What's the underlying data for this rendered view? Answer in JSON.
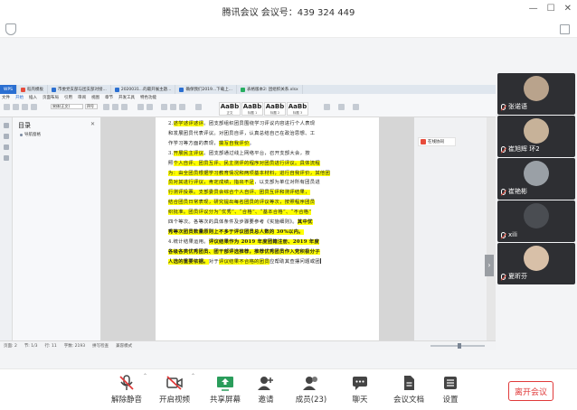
{
  "window": {
    "title": "腾讯会议  会议号：439 324 449"
  },
  "colors": {
    "accent": "#2b6fd1",
    "leave": "#e03a3a",
    "highlight": "#ffff00",
    "tile_bg": "#2e2f33"
  },
  "wps": {
    "tabs": [
      {
        "label": "稻壳模板",
        "color": "#e74c3c"
      },
      {
        "label": "市委党支部与团支部对接...",
        "color": "#2b6fd1"
      },
      {
        "label": "2020031...的最开展主题...",
        "color": "#2b6fd1"
      },
      {
        "label": "确保我们2019...下载上...",
        "color": "#2b6fd1"
      },
      {
        "label": "表格版本2: 团组织关系.xlsx",
        "color": "#27ae60"
      }
    ],
    "menu": [
      "文件",
      "开始",
      "插入",
      "页面布局",
      "引用",
      "审阅",
      "视图",
      "章节",
      "开发工具",
      "特色功能"
    ],
    "active_menu": "开始",
    "font_name": "宋体(正文)",
    "font_size": "四号",
    "styles": [
      {
        "sample": "AaBb",
        "name": "正文"
      },
      {
        "sample": "AaBb",
        "name": "标题 1"
      },
      {
        "sample": "AaBb",
        "name": "标题 2"
      },
      {
        "sample": "AaBb",
        "name": "标题 3"
      }
    ],
    "toc": {
      "title": "目录",
      "close": "✕",
      "item": "导航窗格"
    },
    "side_tag": "在线协同",
    "status": {
      "page": "页面: 2",
      "section": "节: 1/3",
      "column": "行: 11",
      "words": "字数: 2193",
      "spell": "拼写检查",
      "mode": "兼容模式"
    }
  },
  "document": {
    "lines": [
      [
        {
          "t": "2."
        },
        {
          "t": "述学述评述评",
          "c": "hl"
        },
        {
          "t": "。团支部组织团员围绕学习评议内容进行个人表现"
        }
      ],
      [
        {
          "t": "和发展团员代表评议。对团员自评，认真总结自己在政治思想、工"
        }
      ],
      [
        {
          "t": "作学习等方面的表现，"
        },
        {
          "t": "撰写自我评价",
          "c": "hl"
        },
        {
          "t": "。"
        }
      ],
      [
        {
          "t": "3."
        },
        {
          "t": "开展民主评议",
          "c": "hl"
        },
        {
          "t": "。团支部通过线上网络平台，召开支部大会，按"
        }
      ],
      [
        {
          "t": "照"
        },
        {
          "t": "个人自评、团员互评、民主测评",
          "c": "hl"
        },
        {
          "t": "的程序对团员进行评议。具体流程",
          "c": "hl"
        }
      ],
      [
        {
          "t": "为：",
          "c": "hl"
        },
        {
          "t": "由全团员根据学习教育情况和两项基本材料，进行自我评价，其他团",
          "c": "hl"
        }
      ],
      [
        {
          "t": "员对其进行评议，肯定成绩，指出不足",
          "c": "hl"
        },
        {
          "t": "，以支部为单位对所有团员进"
        }
      ],
      [
        {
          "t": "行测评投票。",
          "c": "hl"
        },
        {
          "t": "支部委员会综合个人自评、团员互评和测评结果，",
          "c": "hl"
        }
      ],
      [
        {
          "t": "结合团员日常表现，研究提出每名团员的评议等次，按照程序团员",
          "c": "hl"
        }
      ],
      [
        {
          "t": "织批准。团员评议分为",
          "c": "hl"
        },
        {
          "t": "“优秀”、“合格”、“基本合格”、“不合格”",
          "c": "hl"
        }
      ],
      [
        {
          "t": "四个等次。各等次的具体条件及步骤要参考《实施细则》。"
        },
        {
          "t": "其中优",
          "c": "hl-b"
        }
      ],
      [
        {
          "t": "秀等次团员数量原则上不多于评议团员总人数的 30%以内。",
          "c": "hl-b"
        }
      ],
      [
        {
          "t": "4.统计结果运用。"
        },
        {
          "t": "评议结果作为 2019 年度团籍注册、2019 年度",
          "c": "hl-b"
        }
      ],
      [
        {
          "t": "各级各类优秀团员、团干部评选推荐，推荐优秀团员作入党积极分子",
          "c": "hl-b"
        }
      ],
      [
        {
          "t": "人选的重要依据。",
          "c": "hl-b"
        },
        {
          "t": "对于"
        },
        {
          "t": "评议结果不合格的团员",
          "c": "hl"
        },
        {
          "t": "应帮助其查摆问题或团"
        }
      ]
    ]
  },
  "participants": [
    {
      "name": "张诺语",
      "avatar_color": "#b9a38c"
    },
    {
      "name": "崔旭辉 环2",
      "avatar_color": "#c7b299"
    },
    {
      "name": "崔艳彬",
      "avatar_color": "#9aa0a6"
    },
    {
      "name": "xili",
      "avatar_color": "#4a4d52"
    },
    {
      "name": "夏昕芬",
      "avatar_color": "#d8c0a8"
    }
  ],
  "toolbar": {
    "mute": "解除静音",
    "video": "开启视频",
    "share": "共享屏幕",
    "invite": "邀请",
    "members": "成员(23)",
    "chat": "聊天",
    "docs": "会议文档",
    "settings": "设置",
    "leave": "离开会议"
  }
}
